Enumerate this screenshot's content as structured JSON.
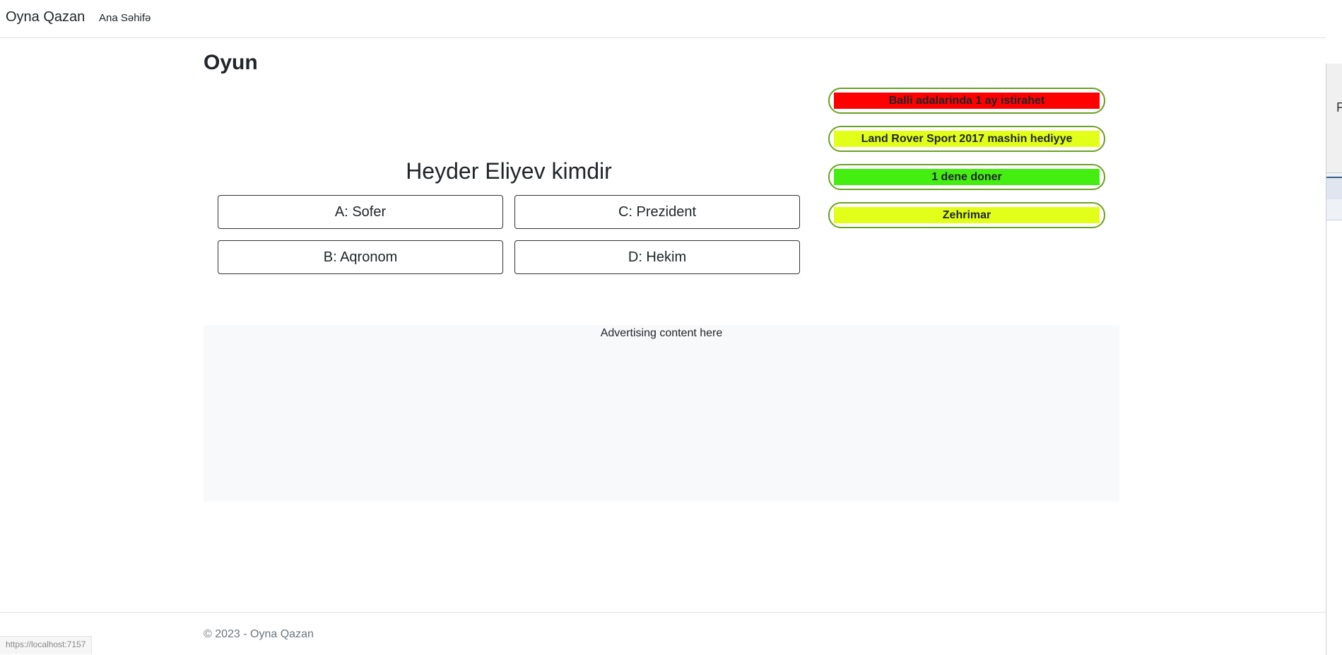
{
  "navbar": {
    "brand": "Oyna Qazan",
    "links": [
      {
        "label": "Ana Səhifə"
      }
    ]
  },
  "main": {
    "title": "Oyun",
    "question": "Heyder Eliyev kimdir",
    "answers": {
      "a": "A: Sofer",
      "b": "B: Aqronom",
      "c": "C: Prezident",
      "d": "D: Hekim"
    }
  },
  "prizes": [
    {
      "label": "Balli adalarinda 1 ay istirahet",
      "color": "#ff0000"
    },
    {
      "label": "Land Rover Sport 2017 mashin hediyye",
      "color": "#e2ff1a"
    },
    {
      "label": "1 dene doner",
      "color": "#44ee11"
    },
    {
      "label": "Zehrimar",
      "color": "#e2ff1a"
    }
  ],
  "advertising": {
    "text": "Advertising content here"
  },
  "footer": {
    "text": "© 2023 - Oyna Qazan"
  },
  "status_bar": {
    "url": "https://localhost:7157"
  },
  "side_window": {
    "letter": "F"
  },
  "colors": {
    "prize_border": "#6aa121",
    "ad_background": "#f8f9fa",
    "footer_text": "#6c757d"
  }
}
